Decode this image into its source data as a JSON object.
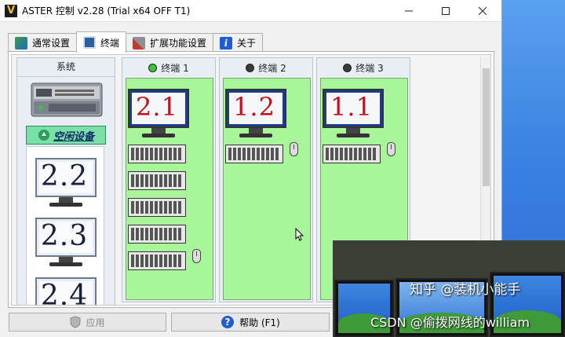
{
  "window": {
    "title": "ASTER 控制 v2.28 (Trial x64 OFF T1)",
    "logo_letter": "V"
  },
  "tabs": [
    {
      "label": "通常设置",
      "icon": "settings-icon",
      "active": false
    },
    {
      "label": "终端",
      "icon": "terminal-icon",
      "active": true
    },
    {
      "label": "扩展功能设置",
      "icon": "tools-icon",
      "active": false
    },
    {
      "label": "关于",
      "icon": "info-icon",
      "active": false
    }
  ],
  "system": {
    "header": "系统",
    "idle_label": "空闲设备",
    "monitors": [
      "2.2",
      "2.3",
      "2.4"
    ]
  },
  "terminals": [
    {
      "name": "终端 1",
      "status": "active",
      "monitor": "2.1",
      "keyboards": 5,
      "mouse_row": 5
    },
    {
      "name": "终端 2",
      "status": "inactive",
      "monitor": "1.2",
      "keyboards": 1,
      "mouse_row": 1
    },
    {
      "name": "终端 3",
      "status": "inactive",
      "monitor": "1.1",
      "keyboards": 1,
      "mouse_row": 1
    }
  ],
  "colors": {
    "active_dot": "#3cc23c",
    "inactive_dot": "#3a3a3a",
    "terminal_bg": "#a8f59a",
    "monitor_label": "#c0101a"
  },
  "buttons": {
    "apply_label": "应用",
    "help_label": "帮助 (F1)"
  },
  "overlay": {
    "watermark_main": "知乎 @装机小能手",
    "watermark_sub": "CSDN @偷拨网线的william"
  }
}
